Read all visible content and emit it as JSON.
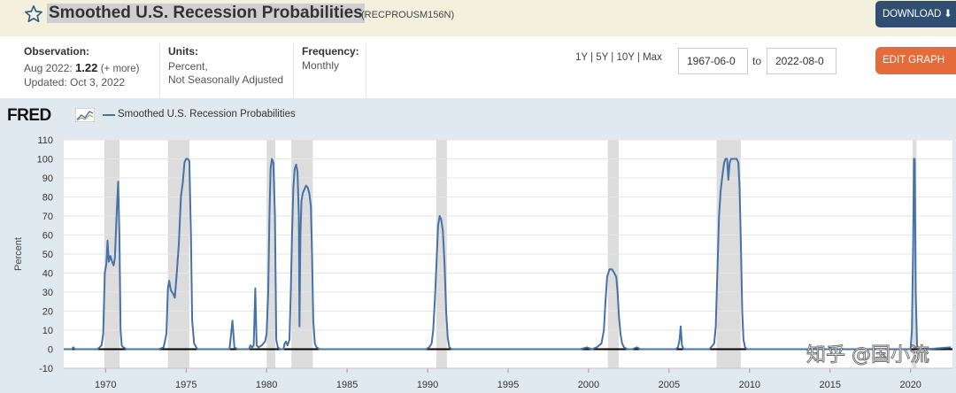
{
  "header": {
    "title": "Smoothed U.S. Recession Probabilities",
    "series_id": "(RECPROUSM156N)",
    "download_label": "DOWNLOAD",
    "bg_color": "#f3f0dd"
  },
  "info": {
    "observation_label": "Observation:",
    "observation_date": "Aug 2022:",
    "observation_value": "1.22",
    "observation_more": "(+ more)",
    "updated": "Updated: Oct 3, 2022",
    "units_label": "Units:",
    "units_line1": "Percent,",
    "units_line2": "Not Seasonally Adjusted",
    "frequency_label": "Frequency:",
    "frequency_value": "Monthly",
    "ranges": "1Y | 5Y | 10Y | Max",
    "date_from": "1967-06-0",
    "to_label": "to",
    "date_to": "2022-08-0",
    "edit_label": "EDIT GRAPH"
  },
  "brand": {
    "logo": "FRED",
    "legend_label": "Smoothed U.S. Recession Probabilities"
  },
  "watermark": "知乎 @国小流",
  "chart_data": {
    "type": "line",
    "title": "",
    "ylabel": "Percent",
    "xlabel": "",
    "xlim": [
      1967.4,
      2022.6
    ],
    "ylim": [
      -10,
      110
    ],
    "y_ticks": [
      -10,
      0,
      10,
      20,
      30,
      40,
      50,
      60,
      70,
      80,
      90,
      100,
      110
    ],
    "x_ticks": [
      1970,
      1975,
      1980,
      1985,
      1990,
      1995,
      2000,
      2005,
      2010,
      2015,
      2020
    ],
    "grid": true,
    "legend": "top-left",
    "line_color": "#4572a7",
    "recession_shading": [
      [
        1969.92,
        1970.87
      ],
      [
        1973.87,
        1975.2
      ],
      [
        1980.0,
        1980.54
      ],
      [
        1981.54,
        1982.87
      ],
      [
        1990.54,
        1991.2
      ],
      [
        2001.2,
        2001.87
      ],
      [
        2007.95,
        2009.45
      ],
      [
        2020.12,
        2020.37
      ]
    ],
    "series": [
      {
        "name": "Smoothed U.S. Recession Probabilities",
        "points": [
          [
            1967.4,
            0
          ],
          [
            1967.9,
            0
          ],
          [
            1968.0,
            1
          ],
          [
            1968.1,
            0
          ],
          [
            1969.5,
            0
          ],
          [
            1969.75,
            2
          ],
          [
            1969.85,
            8
          ],
          [
            1969.95,
            40
          ],
          [
            1970.05,
            45
          ],
          [
            1970.12,
            57
          ],
          [
            1970.2,
            46
          ],
          [
            1970.3,
            49
          ],
          [
            1970.4,
            46
          ],
          [
            1970.5,
            44
          ],
          [
            1970.58,
            48
          ],
          [
            1970.68,
            70
          ],
          [
            1970.78,
            88
          ],
          [
            1970.86,
            60
          ],
          [
            1970.93,
            10
          ],
          [
            1971.0,
            2
          ],
          [
            1971.1,
            1
          ],
          [
            1971.3,
            0
          ],
          [
            1973.3,
            0
          ],
          [
            1973.6,
            1
          ],
          [
            1973.78,
            8
          ],
          [
            1973.87,
            32
          ],
          [
            1973.95,
            36
          ],
          [
            1974.05,
            31
          ],
          [
            1974.2,
            29
          ],
          [
            1974.3,
            27
          ],
          [
            1974.42,
            40
          ],
          [
            1974.55,
            55
          ],
          [
            1974.68,
            80
          ],
          [
            1974.8,
            88
          ],
          [
            1974.9,
            98
          ],
          [
            1975.0,
            100
          ],
          [
            1975.1,
            100
          ],
          [
            1975.2,
            99
          ],
          [
            1975.3,
            60
          ],
          [
            1975.38,
            15
          ],
          [
            1975.5,
            3
          ],
          [
            1975.7,
            0
          ],
          [
            1977.7,
            0
          ],
          [
            1977.88,
            15
          ],
          [
            1978.0,
            1
          ],
          [
            1978.2,
            0
          ],
          [
            1978.9,
            0
          ],
          [
            1979.0,
            2
          ],
          [
            1979.1,
            1
          ],
          [
            1979.2,
            2
          ],
          [
            1979.3,
            32
          ],
          [
            1979.38,
            2
          ],
          [
            1979.5,
            1
          ],
          [
            1979.7,
            2
          ],
          [
            1979.8,
            3
          ],
          [
            1979.9,
            4
          ],
          [
            1980.0,
            8
          ],
          [
            1980.1,
            30
          ],
          [
            1980.18,
            70
          ],
          [
            1980.25,
            95
          ],
          [
            1980.33,
            100
          ],
          [
            1980.42,
            98
          ],
          [
            1980.52,
            70
          ],
          [
            1980.6,
            5
          ],
          [
            1980.7,
            1
          ],
          [
            1980.85,
            0
          ],
          [
            1981.05,
            0
          ],
          [
            1981.12,
            3
          ],
          [
            1981.2,
            4
          ],
          [
            1981.3,
            2
          ],
          [
            1981.42,
            5
          ],
          [
            1981.5,
            30
          ],
          [
            1981.58,
            60
          ],
          [
            1981.66,
            85
          ],
          [
            1981.75,
            95
          ],
          [
            1981.84,
            97
          ],
          [
            1981.92,
            93
          ],
          [
            1982.0,
            70
          ],
          [
            1982.04,
            12
          ],
          [
            1982.1,
            60
          ],
          [
            1982.17,
            78
          ],
          [
            1982.25,
            82
          ],
          [
            1982.35,
            84
          ],
          [
            1982.45,
            86
          ],
          [
            1982.55,
            85
          ],
          [
            1982.65,
            82
          ],
          [
            1982.75,
            75
          ],
          [
            1982.82,
            50
          ],
          [
            1982.9,
            15
          ],
          [
            1983.0,
            3
          ],
          [
            1983.1,
            1
          ],
          [
            1983.3,
            0
          ],
          [
            1989.9,
            0
          ],
          [
            1990.1,
            1
          ],
          [
            1990.25,
            3
          ],
          [
            1990.35,
            10
          ],
          [
            1990.45,
            25
          ],
          [
            1990.55,
            45
          ],
          [
            1990.65,
            65
          ],
          [
            1990.75,
            70
          ],
          [
            1990.85,
            68
          ],
          [
            1990.95,
            62
          ],
          [
            1991.05,
            45
          ],
          [
            1991.15,
            20
          ],
          [
            1991.25,
            6
          ],
          [
            1991.35,
            1
          ],
          [
            1991.5,
            0
          ],
          [
            1999.5,
            0
          ],
          [
            1999.9,
            1
          ],
          [
            2000.2,
            0
          ],
          [
            2000.5,
            1
          ],
          [
            2000.8,
            3
          ],
          [
            2000.95,
            10
          ],
          [
            2001.05,
            25
          ],
          [
            2001.15,
            38
          ],
          [
            2001.3,
            42
          ],
          [
            2001.45,
            42
          ],
          [
            2001.6,
            40
          ],
          [
            2001.72,
            38
          ],
          [
            2001.8,
            30
          ],
          [
            2001.88,
            18
          ],
          [
            2001.98,
            8
          ],
          [
            2002.08,
            3
          ],
          [
            2002.2,
            1
          ],
          [
            2002.4,
            0
          ],
          [
            2002.7,
            0
          ],
          [
            2003.0,
            1
          ],
          [
            2003.2,
            0
          ],
          [
            2005.4,
            0
          ],
          [
            2005.55,
            1
          ],
          [
            2005.65,
            5
          ],
          [
            2005.72,
            12
          ],
          [
            2005.8,
            2
          ],
          [
            2005.9,
            0
          ],
          [
            2007.5,
            0
          ],
          [
            2007.8,
            3
          ],
          [
            2007.9,
            12
          ],
          [
            2008.0,
            40
          ],
          [
            2008.1,
            70
          ],
          [
            2008.2,
            83
          ],
          [
            2008.32,
            92
          ],
          [
            2008.42,
            98
          ],
          [
            2008.5,
            100
          ],
          [
            2008.6,
            100
          ],
          [
            2008.68,
            89
          ],
          [
            2008.76,
            98
          ],
          [
            2008.85,
            100
          ],
          [
            2009.0,
            100
          ],
          [
            2009.2,
            100
          ],
          [
            2009.3,
            98
          ],
          [
            2009.38,
            85
          ],
          [
            2009.46,
            55
          ],
          [
            2009.54,
            20
          ],
          [
            2009.62,
            5
          ],
          [
            2009.72,
            1
          ],
          [
            2009.85,
            0
          ],
          [
            2010.5,
            0
          ],
          [
            2019.9,
            0
          ],
          [
            2020.0,
            0
          ],
          [
            2020.08,
            10
          ],
          [
            2020.16,
            55
          ],
          [
            2020.21,
            100
          ],
          [
            2020.26,
            100
          ],
          [
            2020.32,
            30
          ],
          [
            2020.4,
            2
          ],
          [
            2020.5,
            0
          ],
          [
            2021.0,
            0
          ],
          [
            2022.5,
            1
          ]
        ]
      }
    ]
  }
}
